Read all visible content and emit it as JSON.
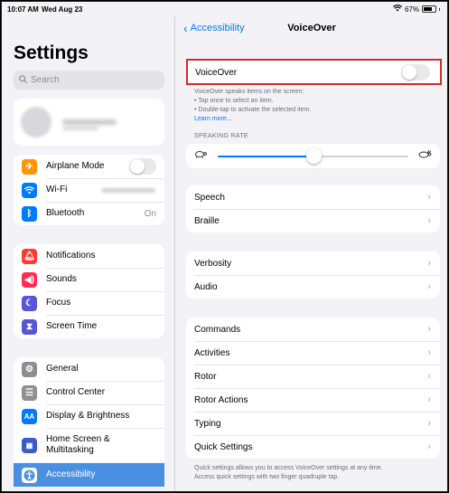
{
  "status": {
    "time": "10:07 AM",
    "date": "Wed Aug 23",
    "battery": "67%"
  },
  "sidebar": {
    "title": "Settings",
    "search_placeholder": "Search",
    "group1": [
      {
        "label": "Airplane Mode",
        "icon": "airplane-icon",
        "color": "#ff9500"
      },
      {
        "label": "Wi-Fi",
        "icon": "wifi-icon",
        "color": "#007aff"
      },
      {
        "label": "Bluetooth",
        "icon": "bluetooth-icon",
        "color": "#007aff",
        "value": "On"
      }
    ],
    "group2": [
      {
        "label": "Notifications",
        "icon": "bell-icon",
        "color": "#ff3b30"
      },
      {
        "label": "Sounds",
        "icon": "speaker-icon",
        "color": "#ff2d55"
      },
      {
        "label": "Focus",
        "icon": "moon-icon",
        "color": "#5856d6"
      },
      {
        "label": "Screen Time",
        "icon": "hourglass-icon",
        "color": "#5856d6"
      }
    ],
    "group3": [
      {
        "label": "General",
        "icon": "gear-icon",
        "color": "#8e8e93"
      },
      {
        "label": "Control Center",
        "icon": "sliders-icon",
        "color": "#8e8e93"
      },
      {
        "label": "Display & Brightness",
        "icon": "aa-icon",
        "color": "#007aff"
      },
      {
        "label": "Home Screen &",
        "label2": "Multitasking",
        "icon": "grid-icon",
        "color": "#3c5ac8"
      },
      {
        "label": "Accessibility",
        "icon": "accessibility-icon",
        "color": "#007aff"
      }
    ]
  },
  "detail": {
    "back_label": "Accessibility",
    "title": "VoiceOver",
    "voiceover_label": "VoiceOver",
    "voiceover_enabled": false,
    "desc1": "VoiceOver speaks items on the screen:",
    "desc2": "• Tap once to select an item.",
    "desc3": "• Double-tap to activate the selected item.",
    "learn_more": "Learn more...",
    "speaking_rate_header": "SPEAKING RATE",
    "speaking_rate": 0.5,
    "group_a": [
      "Speech",
      "Braille"
    ],
    "group_b": [
      "Verbosity",
      "Audio"
    ],
    "group_c": [
      "Commands",
      "Activities",
      "Rotor",
      "Rotor Actions",
      "Typing",
      "Quick Settings"
    ],
    "quick_note1": "Quick settings allows you to access VoiceOver settings at any time.",
    "quick_note2": "Access quick settings with two finger quadruple tap."
  }
}
